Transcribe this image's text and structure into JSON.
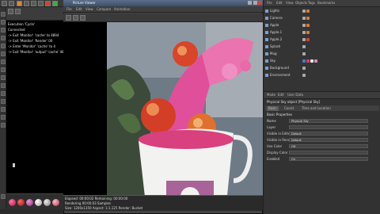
{
  "top_bar": {
    "title": ""
  },
  "console": {
    "lines": [
      "Execution 'Cycle'",
      "Connected",
      "-> Exit 'Monitor' 'cache' to 4894",
      "-> Exit 'Monitor' 'Render' 00",
      "-> Enter 'Monitor' 'cache' to 4",
      "-> Exit 'Monitor' 'output' 'cache' 4894"
    ]
  },
  "viewport": {
    "title": "Picture Viewer",
    "menu": [
      "File",
      "Edit",
      "View",
      "Compare",
      "Animation"
    ],
    "status_lines": [
      "Elapsed: 00:00:02  Remaining: 00:00:00",
      "Rendering   00:00:03   Samples",
      "Size: 1200x1350  Aspect: 1:1.125   Render: Bucket"
    ]
  },
  "object_manager": {
    "tabs": [
      "File",
      "Edit",
      "View",
      "Objects",
      "Tags",
      "Bookmarks"
    ],
    "objects": [
      {
        "name": "Lights",
        "tags": [
          "#aaaaaa",
          "#d87a3a"
        ]
      },
      {
        "name": "Camera",
        "tags": [
          "#aaaaaa",
          "#d87a3a"
        ]
      },
      {
        "name": "Apple",
        "tags": [
          "#aaaaaa",
          "#d87a3a"
        ]
      },
      {
        "name": "Apple.1",
        "tags": [
          "#aaaaaa",
          "#d87a3a"
        ]
      },
      {
        "name": "Apple.2",
        "tags": [
          "#aaaaaa",
          "#d84040"
        ]
      },
      {
        "name": "Splash",
        "tags": [
          "#aaaaaa"
        ]
      },
      {
        "name": "Mug",
        "tags": [
          "#aaaaaa"
        ]
      },
      {
        "name": "Sky",
        "tags": [
          "#3a80d8",
          "#d84060",
          "#e8e8e8",
          "#d090c0"
        ]
      },
      {
        "name": "Background",
        "tags": [
          "#aaaaaa"
        ]
      },
      {
        "name": "Environment",
        "tags": [
          "#aaaaaa"
        ]
      }
    ]
  },
  "attributes": {
    "tabs": [
      "Mode",
      "Edit",
      "User Data"
    ],
    "header": "Physical Sky object [Physical Sky]",
    "section_tabs": [
      "Basic",
      "Coord.",
      "Time and Location"
    ],
    "section_title": "Basic Properties",
    "fields": [
      {
        "label": "Name",
        "value": "Physical Sky"
      },
      {
        "label": "Layer",
        "value": ""
      },
      {
        "label": "Visible in Editor",
        "value": "Default"
      },
      {
        "label": "Visible in Renderer",
        "value": "Default"
      },
      {
        "label": "Use Color",
        "value": "Off"
      },
      {
        "label": "Display Color",
        "value": ""
      },
      {
        "label": "Enabled",
        "value": "On"
      }
    ]
  },
  "colors": {
    "accent_orange": "#d88a3a",
    "title_blue": "#4a5d7a",
    "splash_pink": "#e0509a"
  }
}
